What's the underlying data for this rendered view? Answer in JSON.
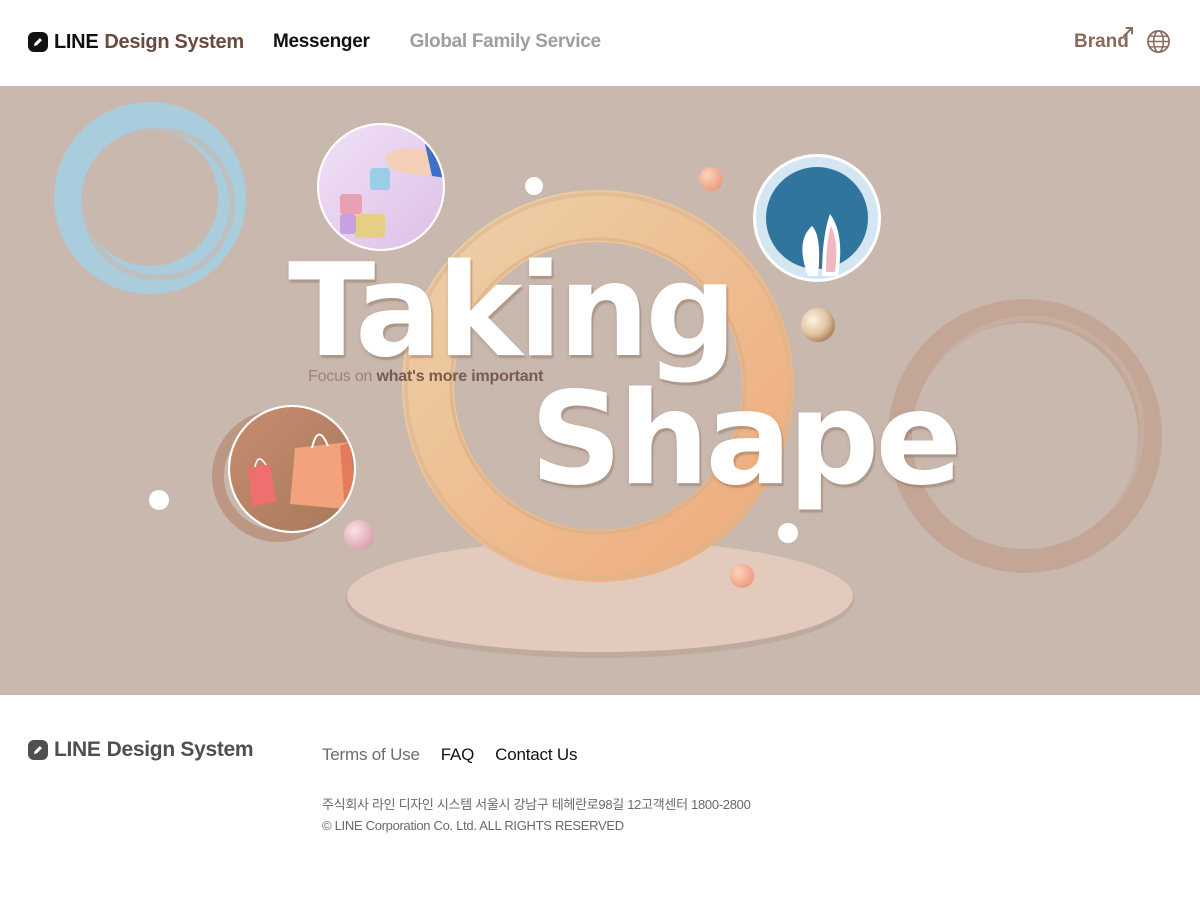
{
  "header": {
    "logo_word": "LINE",
    "logo_suffix": "Design System",
    "nav": [
      {
        "label": "Messenger",
        "active": true
      },
      {
        "label": "Global Family Service",
        "active": false
      }
    ],
    "brand_label": "Brand",
    "icons": {
      "logo": "line-logo-icon",
      "external": "external-link-icon",
      "language": "globe-icon"
    }
  },
  "hero": {
    "title_line1": "Taking",
    "title_line2": "Shape",
    "tagline_prefix": "Focus on",
    "tagline_emphasis": "what's more important",
    "colors": {
      "background": "#c9b8ae",
      "ring": "#e7b98c",
      "platform": "#e2cbbc"
    }
  },
  "footer": {
    "logo_word": "LINE",
    "logo_suffix": "Design System",
    "links": [
      "Terms of Use",
      "FAQ",
      "Contact Us"
    ],
    "address": "주식회사 라인 디자인 시스템 서울시 강남구 테헤란로98길 12고객센터 1800-2800",
    "copyright": "© LINE Corporation  Co. Ltd. ALL RIGHTS RESERVED"
  }
}
